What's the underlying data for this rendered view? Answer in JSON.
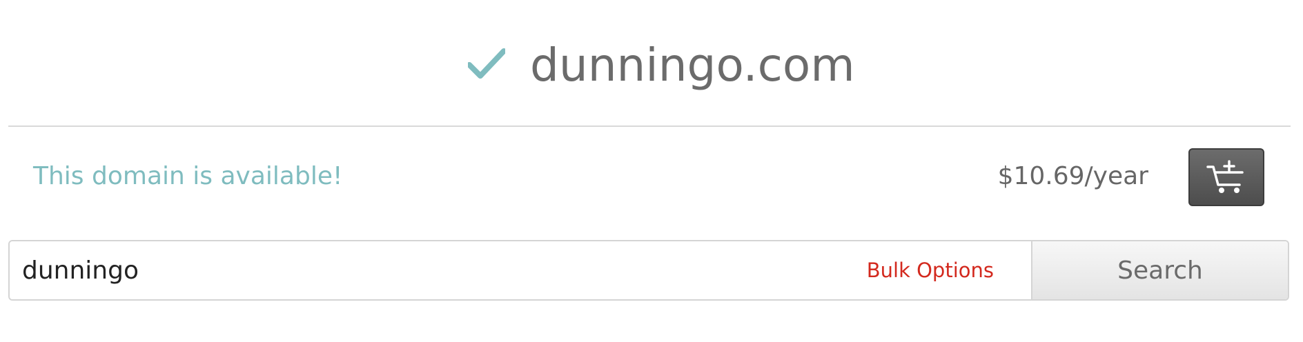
{
  "domain": {
    "name": "dunningo.com",
    "status_icon": "checkmark-icon",
    "status_message": "This domain is available!",
    "price": "$10.69/year"
  },
  "cart": {
    "icon": "add-to-cart-icon"
  },
  "search": {
    "value": "dunningo",
    "bulk_options_label": "Bulk Options",
    "button_label": "Search"
  },
  "colors": {
    "accent_teal": "#7fbcbf",
    "link_red": "#d3291e",
    "title_gray": "#6b6b6b",
    "cart_button": "#5a5a5a"
  }
}
